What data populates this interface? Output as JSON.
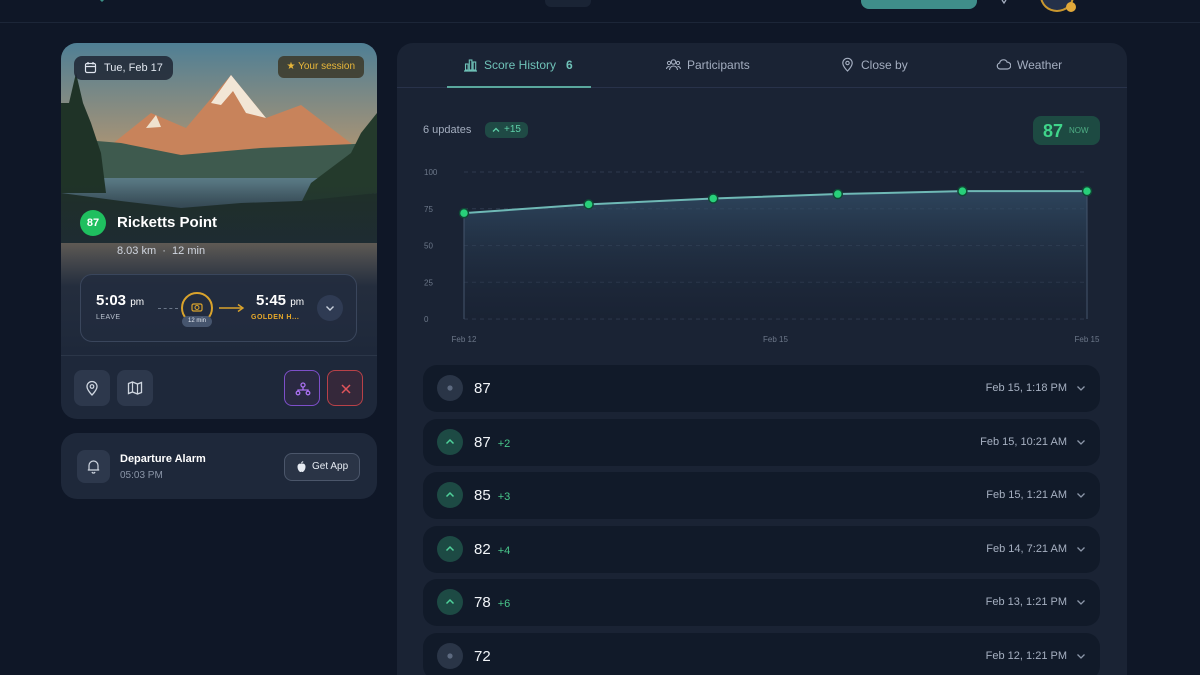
{
  "colors": {
    "accent": "#5aa79d",
    "score_green": "#1fbf5f",
    "golden": "#e7a92a",
    "danger": "#b84148",
    "share": "#7d4fc9"
  },
  "card": {
    "date": "Tue, Feb 17",
    "session_label": "Your session",
    "score": "87",
    "location": "Ricketts Point",
    "distance": "8.03 km",
    "drive": "12 min",
    "leave_time": "5:03",
    "leave_ampm": "pm",
    "leave_label": "LEAVE",
    "duration": "12 min",
    "arrive_time": "5:45",
    "arrive_ampm": "pm",
    "arrive_label": "GOLDEN H...",
    "icons": [
      "calendar-icon",
      "star-icon",
      "camera-icon",
      "chevron-down-icon",
      "map-pin-icon",
      "map-icon",
      "share-icon",
      "close-icon"
    ]
  },
  "alarm": {
    "title": "Departure Alarm",
    "time": "05:03 PM",
    "button": "Get App"
  },
  "tabs": [
    {
      "label": "Score History",
      "count": "6",
      "icon": "bar-chart-icon"
    },
    {
      "label": "Participants",
      "icon": "users-icon"
    },
    {
      "label": "Close by",
      "icon": "map-pin-icon"
    },
    {
      "label": "Weather",
      "icon": "cloud-icon"
    }
  ],
  "summary": {
    "updates": "6 updates",
    "change": "+15",
    "now_value": "87",
    "now_label": "NOW"
  },
  "chart_data": {
    "type": "area",
    "x": [
      "Feb 12, 1:21 PM",
      "Feb 13, 1:21 PM",
      "Feb 14, 7:21 AM",
      "Feb 15, 1:21 AM",
      "Feb 15, 10:21 AM",
      "Feb 15, 1:18 PM"
    ],
    "values": [
      72,
      78,
      82,
      85,
      87,
      87
    ],
    "y_ticks": [
      "100",
      "75",
      "50",
      "25",
      "0"
    ],
    "ylim": [
      0,
      100
    ],
    "x_tick_labels": [
      "Feb 12",
      "Feb 15",
      "Feb 15"
    ],
    "grid": true
  },
  "history": [
    {
      "value": "87",
      "delta": "",
      "date": "Feb 15, 1:18 PM",
      "trend": "flat"
    },
    {
      "value": "87",
      "delta": "+2",
      "date": "Feb 15, 10:21 AM",
      "trend": "up"
    },
    {
      "value": "85",
      "delta": "+3",
      "date": "Feb 15, 1:21 AM",
      "trend": "up"
    },
    {
      "value": "82",
      "delta": "+4",
      "date": "Feb 14, 7:21 AM",
      "trend": "up"
    },
    {
      "value": "78",
      "delta": "+6",
      "date": "Feb 13, 1:21 PM",
      "trend": "up"
    },
    {
      "value": "72",
      "delta": "",
      "date": "Feb 12, 1:21 PM",
      "trend": "flat"
    }
  ]
}
